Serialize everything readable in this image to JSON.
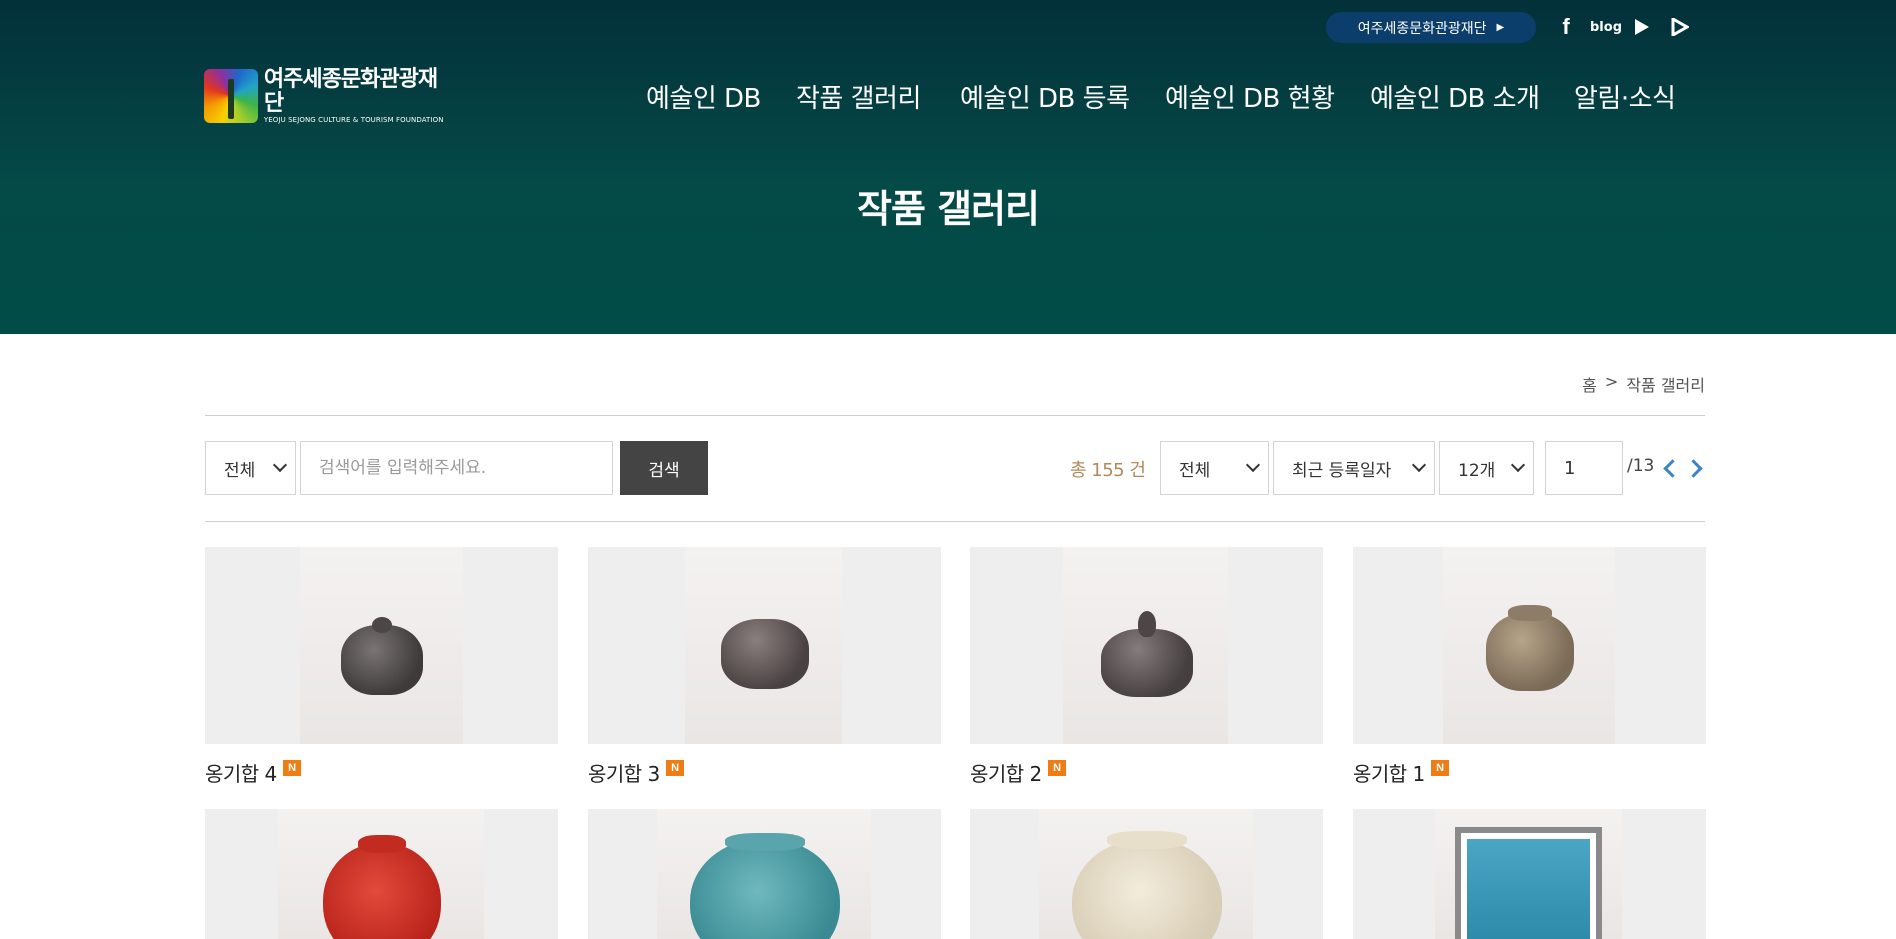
{
  "topbar": {
    "foundation_link": "여주세종문화관광재단",
    "foundation_arrow": "▶",
    "social": [
      {
        "name": "facebook",
        "label": "f"
      },
      {
        "name": "blog",
        "label": "blog"
      },
      {
        "name": "youtube",
        "label": "▶"
      },
      {
        "name": "play",
        "label": "▷"
      }
    ]
  },
  "logo": {
    "korean": "여주세종문화관광재단",
    "english": "YEOJU SEJONG CULTURE & TOURISM FOUNDATION"
  },
  "nav": {
    "items": [
      "예술인 DB",
      "작품 갤러리",
      "예술인 DB 등록",
      "예술인 DB 현황",
      "예술인 DB 소개",
      "알림·소식"
    ]
  },
  "page": {
    "title": "작품 갤러리"
  },
  "breadcrumb": {
    "home": "홈",
    "separator": ">",
    "current": "작품 갤러리"
  },
  "search": {
    "category_value": "전체",
    "placeholder": "검색어를 입력해주세요.",
    "button": "검색"
  },
  "listing": {
    "total_label": "총 155 건",
    "filter_value": "전체",
    "sort_value": "최근 등록일자",
    "per_page_value": "12개",
    "current_page": "1",
    "total_pages": "/13"
  },
  "gallery": {
    "items": [
      {
        "title": "옹기합 4",
        "new_badge": "N"
      },
      {
        "title": "옹기합 3",
        "new_badge": "N"
      },
      {
        "title": "옹기합 2",
        "new_badge": "N"
      },
      {
        "title": "옹기합 1",
        "new_badge": "N"
      },
      {
        "title": ""
      },
      {
        "title": ""
      },
      {
        "title": ""
      },
      {
        "title": ""
      }
    ]
  },
  "colors": {
    "hero": "#014c47",
    "pill": "#0b3e6b",
    "total_text": "#b08b5a",
    "pager_arrow": "#3c84c9",
    "new_badge": "#f07c14",
    "search_button": "#444444"
  }
}
